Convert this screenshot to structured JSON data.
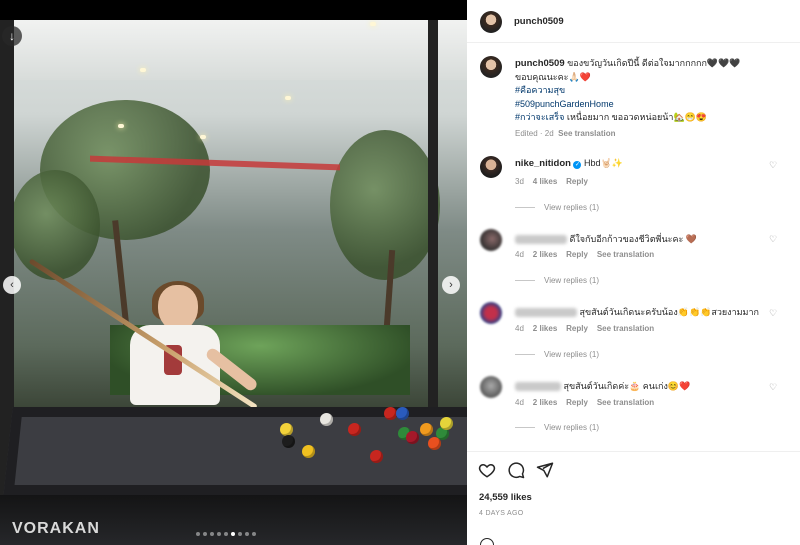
{
  "post": {
    "owner": "punch0509",
    "caption": {
      "text": "ของขวัญวันเกิดปีนี้ ดีต่อใจมากกกกก🖤🖤🖤",
      "line2": "ขอบคุณนะคะ🙏🏻❤️",
      "hashtags": [
        "#คือความสุข",
        "#509punchGardenHome",
        "#กว่าจะเสร็จ"
      ],
      "line_after_tag": "เหนื่อยมาก ขออวดหน่อยน้า🏡😁😍",
      "edited": "Edited · 2d",
      "see_translation": "See translation"
    },
    "media": {
      "brand_text": "VORAKAN",
      "dots": 9,
      "active_dot": 5
    },
    "likes": "24,559 likes",
    "date": "4 DAYS AGO"
  },
  "comments": [
    {
      "username": "nike_nitidon",
      "verified": true,
      "text": "Hbd🤘🏻✨",
      "time": "3d",
      "likes": "4 likes",
      "reply": "Reply",
      "translate": "",
      "view_replies": "View replies (1)",
      "blurred": false
    },
    {
      "username": "",
      "verified": false,
      "text": "ดีใจกับอีกก้าวของชีวิตพี่นะคะ 🤎",
      "time": "4d",
      "likes": "2 likes",
      "reply": "Reply",
      "translate": "See translation",
      "view_replies": "View replies (1)",
      "blurred": true
    },
    {
      "username": "",
      "verified": false,
      "text": "สุขสันต์วันเกิดนะครับน้อง👏👏👏สวยงามมาก",
      "time": "4d",
      "likes": "2 likes",
      "reply": "Reply",
      "translate": "See translation",
      "view_replies": "View replies (1)",
      "blurred": true
    },
    {
      "username": "",
      "verified": false,
      "text": "สุขสันต์วันเกิดค่ะ🎂 คนเก่ง😊❤️",
      "time": "4d",
      "likes": "2 likes",
      "reply": "Reply",
      "translate": "See translation",
      "view_replies": "View replies (1)",
      "blurred": true
    }
  ],
  "colors": {
    "link": "#00376b",
    "verified": "#0095f6",
    "muted": "#8e8e8e"
  }
}
